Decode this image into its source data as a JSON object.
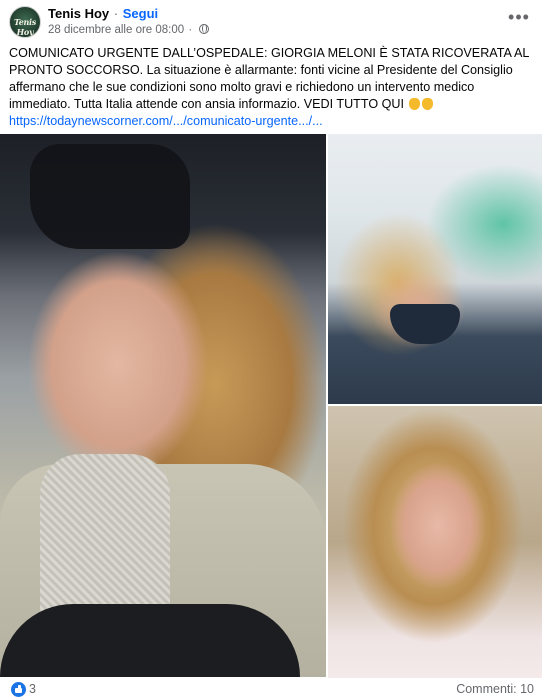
{
  "post": {
    "page_name": "Tenis Hoy",
    "separator": "·",
    "follow_label": "Segui",
    "timestamp": "28 dicembre alle ore 08:00",
    "privacy_icon": "globe-icon",
    "more_icon": "more-options-icon",
    "more_label": "•••",
    "avatar_text": "Tenis Hoy",
    "caption_text": "COMUNICATO URGENTE DALL’OSPEDALE: GIORGIA MELONI È STATA RICOVERATA AL PRONTO SOCCORSO. La situazione è allarmante: fonti vicine al Presidente del Consiglio affermano che le sue condizioni sono molto gravi e richiedono un intervento medico immediato. Tutta Italia attende con ansia informazio. VEDI TUTTO QUI ",
    "caption_emojis": [
      "pointing-down-emoji",
      "pointing-down-emoji"
    ],
    "caption_link": "https://todaynewscorner.com/.../comunicato-urgente.../..."
  },
  "photos": [
    {
      "name": "photo-main",
      "alt": "Woman with blond hair, eyes closed, seated in a car"
    },
    {
      "name": "photo-top-right",
      "alt": "Woman with blond hair wearing a face mask, bending forward"
    },
    {
      "name": "photo-bottom-right",
      "alt": "Woman with blond hair looking down"
    }
  ],
  "footer": {
    "like_icon": "like-icon",
    "reactions_count": "3",
    "comments_label": "Commenti: 10"
  },
  "colors": {
    "link": "#0866ff",
    "secondary_text": "#65676b",
    "like_badge": "#1b74e4"
  }
}
